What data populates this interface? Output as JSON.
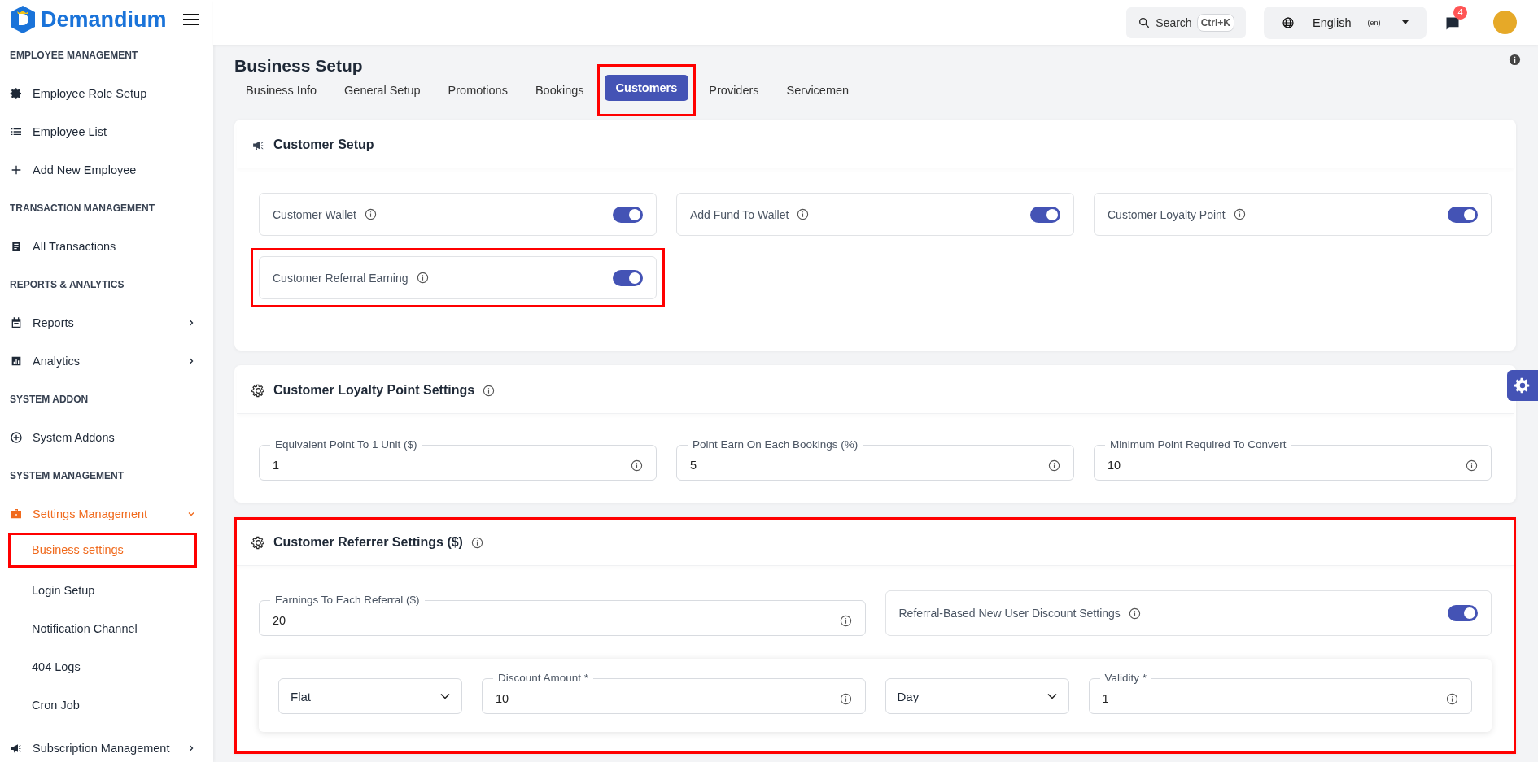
{
  "brand": {
    "name": "Demandium"
  },
  "sidebar": {
    "sections": [
      {
        "heading": "EMPLOYEE MANAGEMENT",
        "items": [
          {
            "label": "Employee Role Setup",
            "selected": false
          },
          {
            "label": "Employee List",
            "selected": false
          },
          {
            "label": "Add New Employee",
            "selected": false
          }
        ]
      },
      {
        "heading": "TRANSACTION MANAGEMENT",
        "items": [
          {
            "label": "All Transactions",
            "selected": false
          }
        ]
      },
      {
        "heading": "REPORTS & ANALYTICS",
        "items": [
          {
            "label": "Reports",
            "selected": false,
            "expanded": false
          },
          {
            "label": "Analytics",
            "selected": false,
            "expanded": false
          }
        ]
      },
      {
        "heading": "SYSTEM ADDON",
        "items": [
          {
            "label": "System Addons",
            "selected": false
          }
        ]
      },
      {
        "heading": "SYSTEM MANAGEMENT",
        "items": [
          {
            "label": "Settings Management",
            "selected": true,
            "expanded": true,
            "children": [
              {
                "label": "Business settings",
                "selected": true,
                "highlighted": true
              },
              {
                "label": "Login Setup",
                "selected": false,
                "highlighted": false
              },
              {
                "label": "Notification Channel",
                "selected": false,
                "highlighted": false
              },
              {
                "label": "404 Logs",
                "selected": false,
                "highlighted": false
              },
              {
                "label": "Cron Job",
                "selected": false,
                "highlighted": false
              }
            ]
          },
          {
            "label": "Subscription Management",
            "selected": false,
            "expanded": false
          }
        ]
      }
    ]
  },
  "topbar": {
    "search": {
      "label": "Search",
      "shortcut": "Ctrl+K"
    },
    "language": {
      "label": "English",
      "code": "(en)"
    },
    "notifications": {
      "count": "4"
    }
  },
  "page": {
    "title": "Business Setup"
  },
  "tabs": [
    {
      "label": "Business Info",
      "selected": false,
      "highlighted": false
    },
    {
      "label": "General Setup",
      "selected": false,
      "highlighted": false
    },
    {
      "label": "Promotions",
      "selected": false,
      "highlighted": false
    },
    {
      "label": "Bookings",
      "selected": false,
      "highlighted": false
    },
    {
      "label": "Customers",
      "selected": true,
      "highlighted": true
    },
    {
      "label": "Providers",
      "selected": false,
      "highlighted": false
    },
    {
      "label": "Servicemen",
      "selected": false,
      "highlighted": false
    }
  ],
  "sections": [
    {
      "kind": "toggles",
      "title": "Customer Setup",
      "info": false,
      "highlighted": false,
      "toggles": [
        {
          "label": "Customer Wallet",
          "on": true,
          "highlighted": false
        },
        {
          "label": "Add Fund To Wallet",
          "on": true,
          "highlighted": false
        },
        {
          "label": "Customer Loyalty Point",
          "on": true,
          "highlighted": false
        },
        {
          "label": "Customer Referral Earning",
          "on": true,
          "highlighted": true
        }
      ]
    },
    {
      "kind": "fields",
      "title": "Customer Loyalty Point Settings",
      "info": true,
      "highlighted": false,
      "fields": [
        {
          "label": "Equivalent Point To 1 Unit ($)",
          "value": "1"
        },
        {
          "label": "Point Earn On Each Bookings (%)",
          "value": "5"
        },
        {
          "label": "Minimum Point Required To Convert",
          "value": "10"
        }
      ]
    },
    {
      "kind": "referrer",
      "title": "Customer Referrer Settings ($)",
      "info": true,
      "highlighted": true,
      "field": {
        "label": "Earnings To Each Referral ($)",
        "value": "20"
      },
      "toggle": {
        "label": "Referral-Based New User Discount Settings",
        "on": true
      },
      "discount": [
        {
          "kind": "select",
          "value": "Flat"
        },
        {
          "kind": "input",
          "label": "Discount Amount *",
          "value": "10"
        },
        {
          "kind": "select",
          "value": "Day"
        },
        {
          "kind": "input",
          "label": "Validity *",
          "value": "1"
        }
      ]
    }
  ]
}
